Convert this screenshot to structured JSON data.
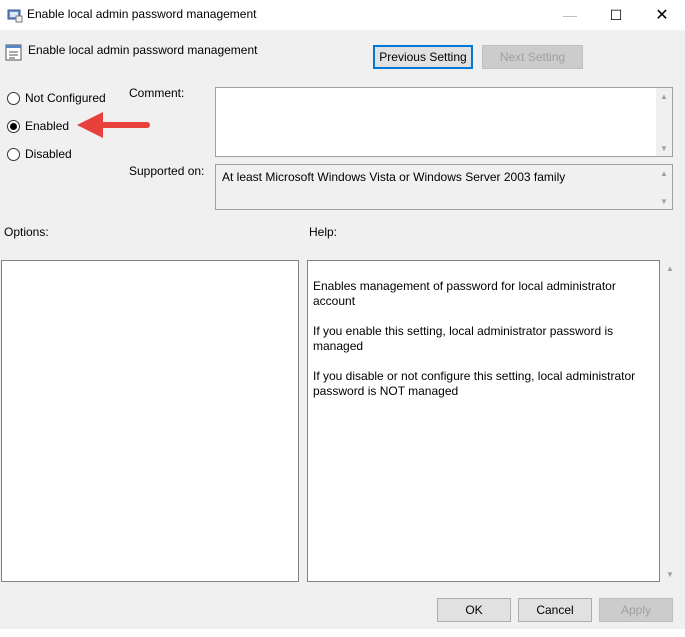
{
  "window": {
    "title": "Enable local admin password management",
    "minimize": "—",
    "maximize": "☐",
    "close": "✕"
  },
  "header": {
    "policy_name": "Enable local admin password management",
    "previous_setting": "Previous Setting",
    "next_setting": "Next Setting"
  },
  "state": {
    "options": [
      {
        "label": "Not Configured",
        "checked": false
      },
      {
        "label": "Enabled",
        "checked": true
      },
      {
        "label": "Disabled",
        "checked": false
      }
    ]
  },
  "comment": {
    "label": "Comment:",
    "value": ""
  },
  "supported": {
    "label": "Supported on:",
    "value": "At least Microsoft Windows Vista or Windows Server 2003 family"
  },
  "options_pane": {
    "label": "Options:"
  },
  "help_pane": {
    "label": "Help:",
    "paragraphs": [
      "Enables management of password for local administrator account",
      "If you enable this setting, local administrator password is managed",
      "If you disable or not configure this setting, local administrator password is NOT managed"
    ]
  },
  "footer": {
    "ok": "OK",
    "cancel": "Cancel",
    "apply": "Apply"
  },
  "colors": {
    "accent": "#0078d7",
    "annotation_arrow": "#e8403a"
  }
}
